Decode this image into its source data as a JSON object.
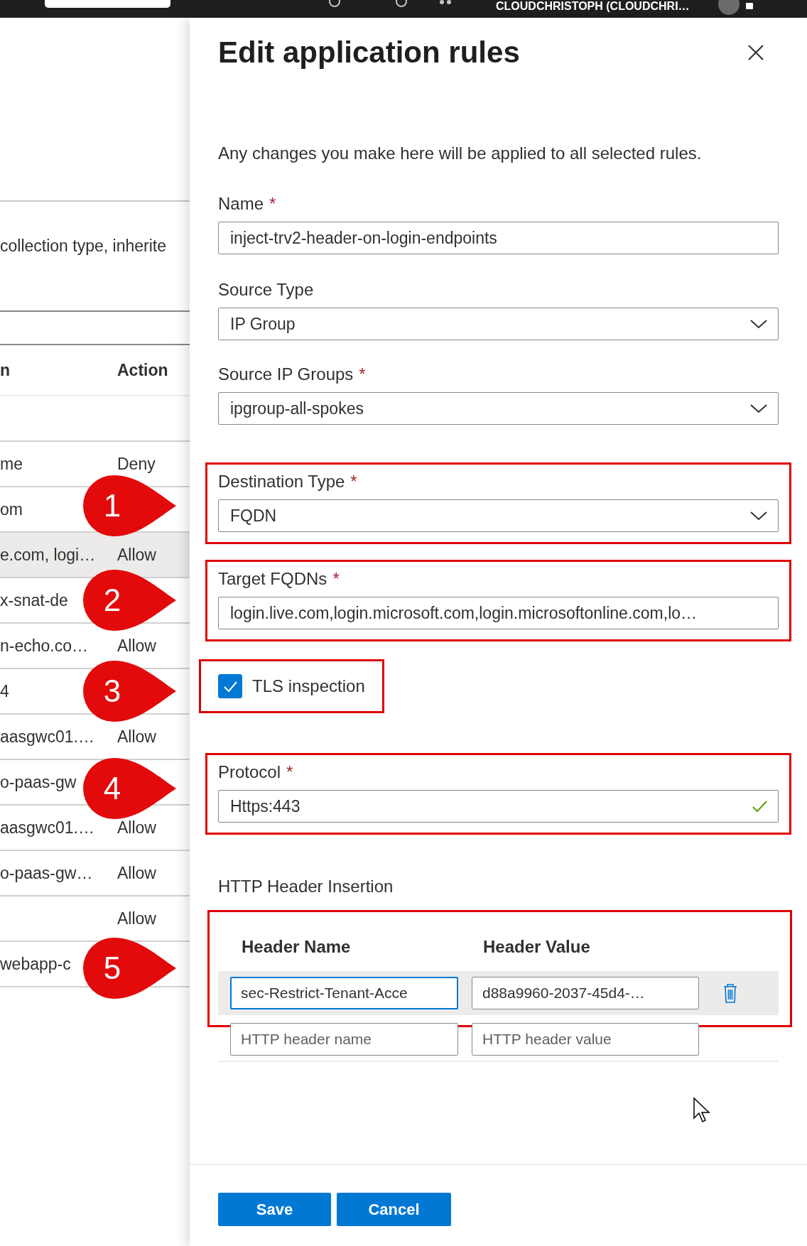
{
  "top_bar": {
    "account": "CLOUDCHRISTOPH (CLOUDCHRI…"
  },
  "background_table": {
    "description": "collection type, inherite",
    "columns": [
      "n",
      "Action"
    ],
    "rows": [
      {
        "column_1": "me",
        "action": "Deny",
        "selected": false
      },
      {
        "column_1": "om",
        "selected": false
      },
      {
        "column_1": "e.com, logi…",
        "action": "Allow",
        "selected": true
      },
      {
        "column_1": "x-snat-de",
        "selected": false
      },
      {
        "column_1": "n-echo.co…",
        "action": "Allow",
        "selected": false
      },
      {
        "column_1": "4",
        "selected": false
      },
      {
        "column_1": "aasgwc01.…",
        "action": "Allow",
        "selected": false
      },
      {
        "column_1": "o-paas-gw",
        "selected": false
      },
      {
        "column_1": "aasgwc01.…",
        "action": "Allow",
        "selected": false
      },
      {
        "column_1": "o-paas-gw…",
        "action": "Allow",
        "selected": false
      },
      {
        "column_1": "",
        "action": "Allow",
        "selected": false
      },
      {
        "column_1": "webapp-c",
        "selected": false
      }
    ]
  },
  "callouts": [
    "1",
    "2",
    "3",
    "4",
    "5"
  ],
  "panel": {
    "title": "Edit application rules",
    "description": "Any changes you make here will be applied to all selected rules.",
    "fields": [
      {
        "kind": "text",
        "label": "Name",
        "required_mark": "*",
        "value": "inject-trv2-header-on-login-endpoints",
        "valid": false,
        "highlighted": false
      },
      {
        "kind": "dropdown",
        "label": "Source Type",
        "value": "IP Group",
        "highlighted": false
      },
      {
        "kind": "dropdown",
        "label": "Source IP Groups",
        "required_mark": "*",
        "value": "ipgroup-all-spokes",
        "highlighted": false
      },
      {
        "kind": "dropdown",
        "label": "Destination Type",
        "required_mark": "*",
        "value": "FQDN",
        "highlighted": true
      },
      {
        "kind": "text",
        "label": "Target FQDNs",
        "required_mark": "*",
        "value": "login.live.com,login.microsoft.com,login.microsoftonline.com,lo…",
        "valid": false,
        "highlighted": true
      },
      {
        "kind": "checkbox",
        "label": "TLS inspection",
        "checked": true,
        "highlighted": true
      },
      {
        "kind": "text",
        "label": "Protocol",
        "required_mark": "*",
        "value": "Https:443",
        "valid": true,
        "highlighted": true
      }
    ],
    "header_insertion": {
      "label": "HTTP Header Insertion",
      "highlighted": true,
      "columns": [
        "Header Name",
        "Header Value"
      ],
      "rows": [
        {
          "name": "sec-Restrict-Tenant-Acce",
          "value": "d88a9960-2037-45d4-…",
          "selected": true
        }
      ],
      "new_row": {
        "name_placeholder": "HTTP header name",
        "value_placeholder": "HTTP header value"
      }
    },
    "buttons": [
      {
        "label": "Save"
      },
      {
        "label": "Cancel"
      }
    ]
  }
}
